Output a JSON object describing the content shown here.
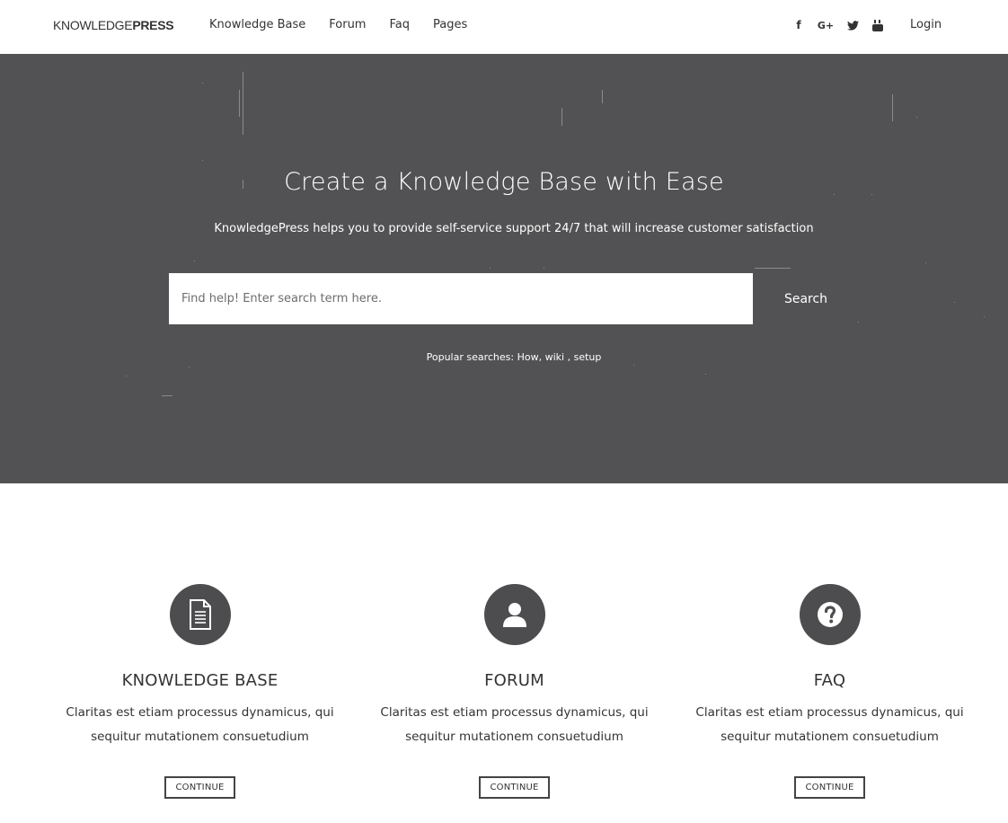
{
  "header": {
    "logo_light": "KNOWLEDGE",
    "logo_bold": "PRESS",
    "nav": [
      {
        "label": "Knowledge Base"
      },
      {
        "label": "Forum"
      },
      {
        "label": "Faq"
      },
      {
        "label": "Pages"
      }
    ],
    "social": {
      "facebook": "f",
      "google": "G+",
      "twitter": "t",
      "youtube": "▶"
    },
    "login_label": "Login"
  },
  "hero": {
    "title": "Create a Knowledge Base with Ease",
    "subtitle": "KnowledgePress helps you to provide self-service support 24/7 that will increase customer satisfaction",
    "search": {
      "placeholder": "Find help! Enter search term here.",
      "button_label": "Search"
    },
    "popular": {
      "label": "Popular searches:",
      "terms": [
        "How",
        "wiki",
        "setup"
      ],
      "sep1": ",",
      "sep2": ",",
      "space": " "
    },
    "background_color": "#525254"
  },
  "features": [
    {
      "icon": "document-icon",
      "title": "KNOWLEDGE BASE",
      "text": "Claritas est etiam processus dynamicus, qui sequitur mutationem consuetudium",
      "button_label": "CONTINUE"
    },
    {
      "icon": "user-icon",
      "title": "FORUM",
      "text": "Claritas est etiam processus dynamicus, qui sequitur mutationem consuetudium",
      "button_label": "CONTINUE"
    },
    {
      "icon": "question-icon",
      "title": "FAQ",
      "text": "Claritas est etiam processus dynamicus, qui sequitur mutationem consuetudium",
      "button_label": "CONTINUE"
    }
  ]
}
